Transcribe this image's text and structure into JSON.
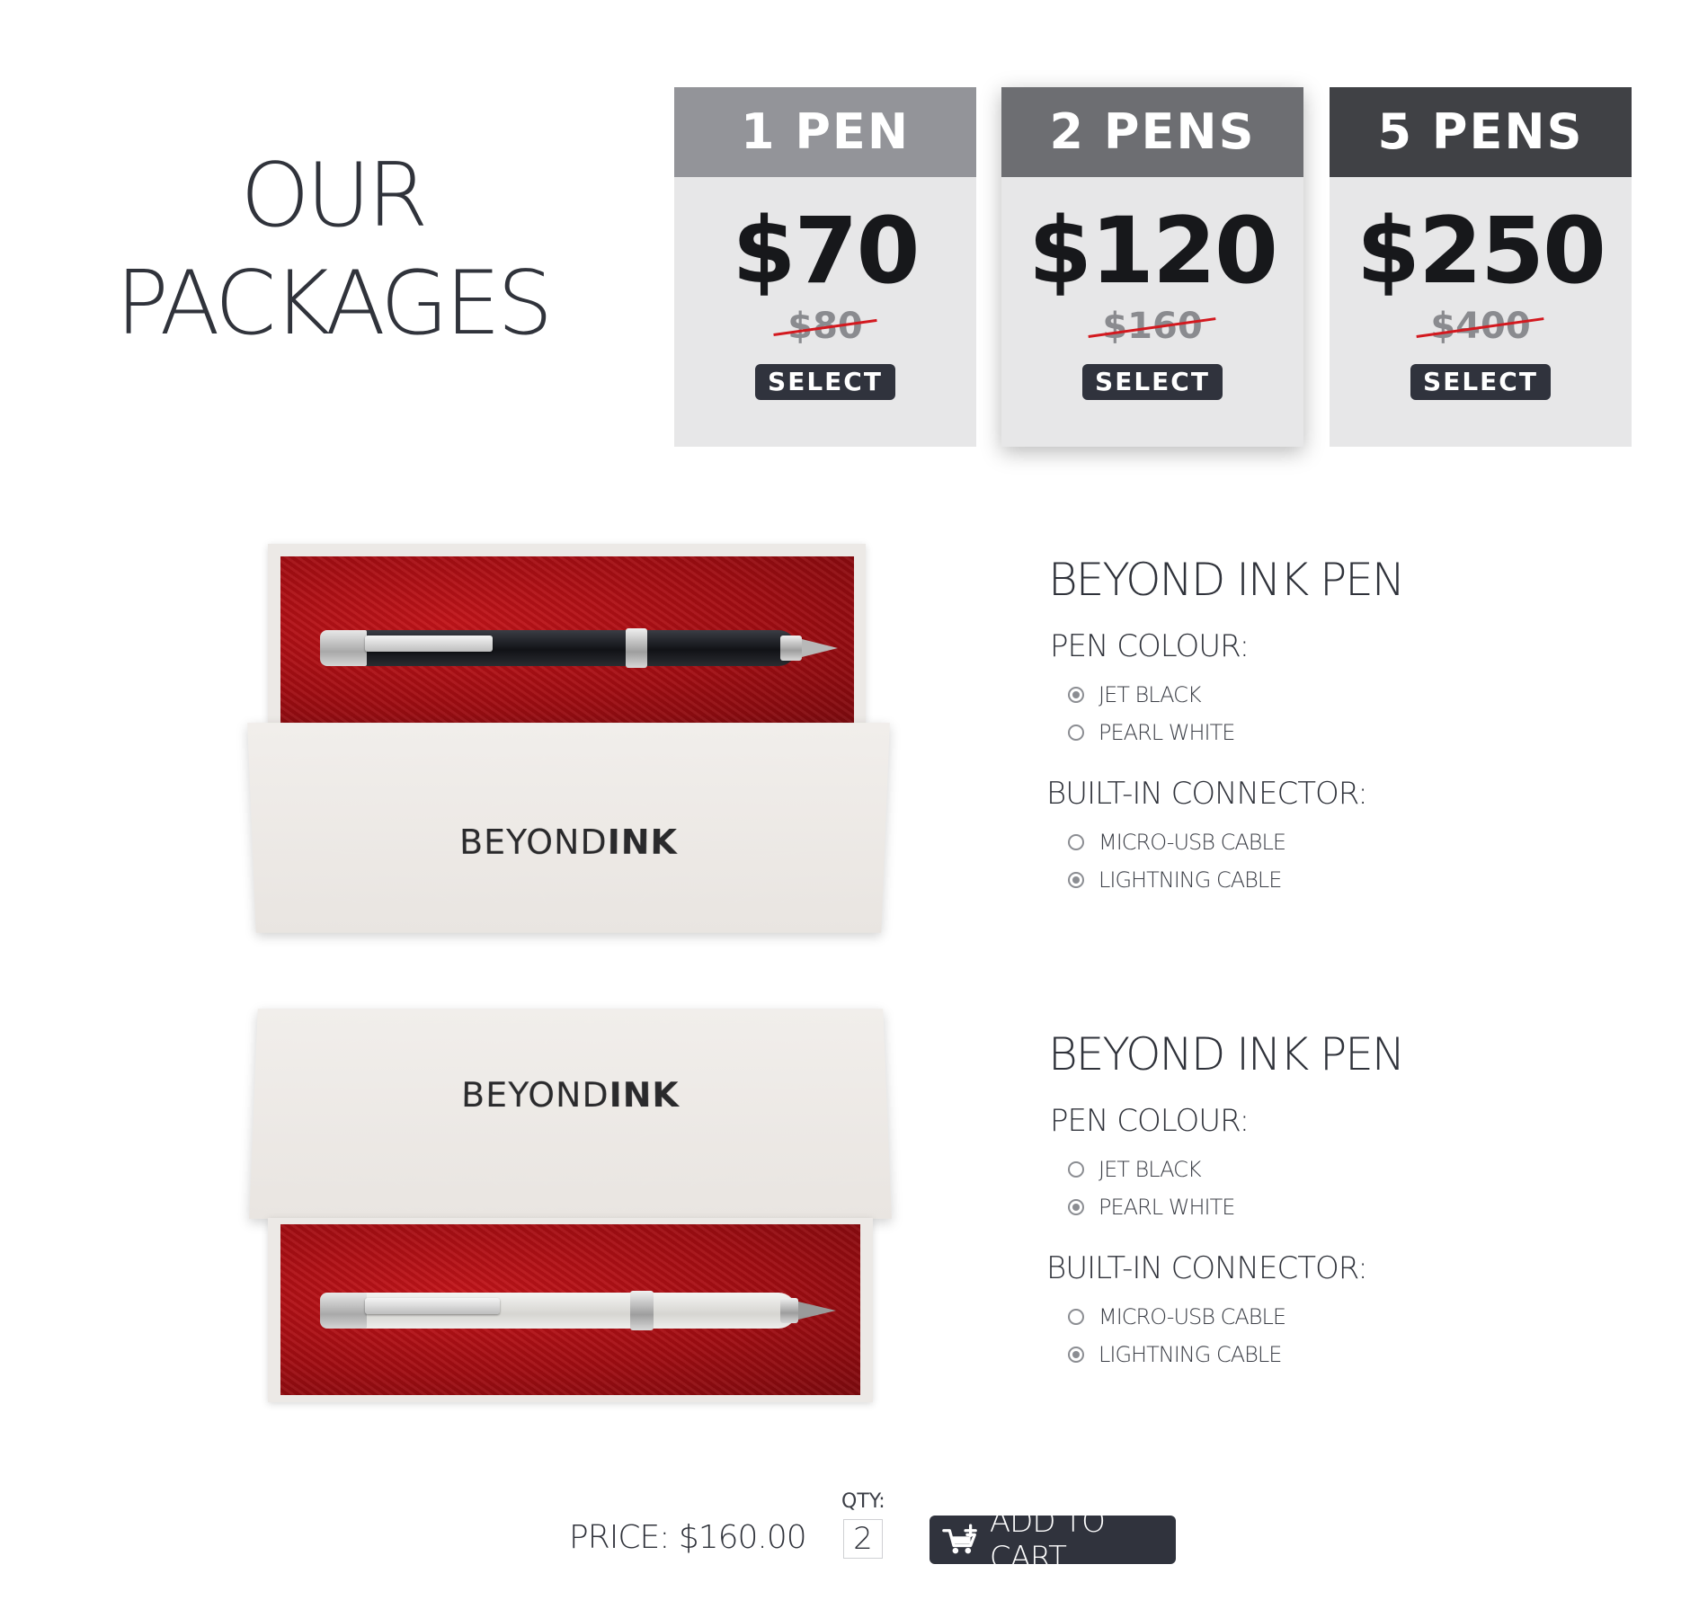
{
  "heading": {
    "line1": "OUR",
    "line2": "PACKAGES"
  },
  "packages": [
    {
      "label": "1 PEN",
      "price": "$70",
      "old_price": "$80",
      "button": "SELECT"
    },
    {
      "label": "2 PENS",
      "price": "$120",
      "old_price": "$160",
      "button": "SELECT"
    },
    {
      "label": "5 PENS",
      "price": "$250",
      "old_price": "$400",
      "button": "SELECT"
    }
  ],
  "products": [
    {
      "brand_light": "BEYOND",
      "brand_bold": "INK",
      "title": "BEYOND INK PEN",
      "colour_label": "PEN COLOUR:",
      "colours": [
        "JET BLACK",
        "PEARL WHITE"
      ],
      "colour_selected": "JET BLACK",
      "connector_label": "BUILT-IN CONNECTOR:",
      "connectors": [
        "MICRO-USB CABLE",
        "LIGHTNING CABLE"
      ],
      "connector_selected": "LIGHTNING CABLE"
    },
    {
      "brand_light": "BEYOND",
      "brand_bold": "INK",
      "title": "BEYOND INK PEN",
      "colour_label": "PEN COLOUR:",
      "colours": [
        "JET BLACK",
        "PEARL WHITE"
      ],
      "colour_selected": "PEARL WHITE",
      "connector_label": "BUILT-IN CONNECTOR:",
      "connectors": [
        "MICRO-USB CABLE",
        "LIGHTNING CABLE"
      ],
      "connector_selected": "LIGHTNING CABLE"
    }
  ],
  "footer": {
    "price_label": "PRICE:",
    "price_value": "$160.00",
    "qty_label": "QTY:",
    "qty_value": "2",
    "cart_label": "ADD TO CART"
  },
  "icons": {
    "cart": "cart-add-icon"
  },
  "colors": {
    "accent": "#30333d",
    "strike": "#d3191f",
    "velvet": "#a10d12"
  }
}
